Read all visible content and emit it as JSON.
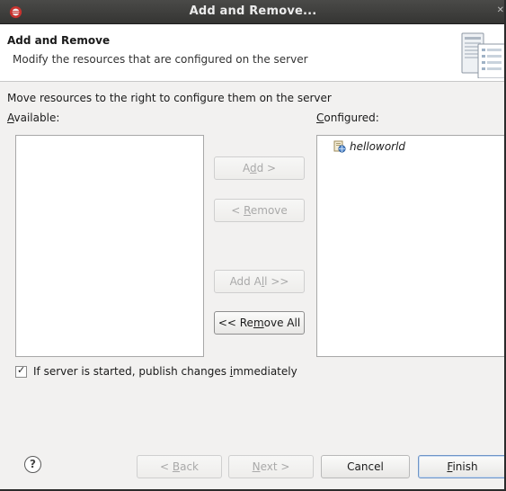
{
  "window": {
    "title": "Add and Remove..."
  },
  "header": {
    "title": "Add and Remove",
    "description": "Modify the resources that are configured on the server"
  },
  "instruction": "Move resources to the right to configure them on the server",
  "available": {
    "label_mnemonic": "A",
    "label_rest": "vailable:",
    "items": []
  },
  "configured": {
    "label_mnemonic": "C",
    "label_rest": "onfigured:",
    "items": [
      {
        "label": "helloworld",
        "icon": "web-project-icon"
      }
    ]
  },
  "buttons": {
    "add": {
      "pre": "A",
      "mn": "d",
      "post": "d >",
      "enabled": false
    },
    "remove": {
      "pre": "< ",
      "mn": "R",
      "post": "emove",
      "enabled": false
    },
    "add_all": {
      "pre": "Add A",
      "mn": "l",
      "post": "l >>",
      "enabled": false
    },
    "remove_all": {
      "pre": "<< Re",
      "mn": "m",
      "post": "ove All",
      "enabled": true
    }
  },
  "publish": {
    "checked": true,
    "pre": "If server is started, publish changes ",
    "mn": "i",
    "post": "mmediately"
  },
  "footer": {
    "help_glyph": "?",
    "back": {
      "pre": "< ",
      "mn": "B",
      "post": "ack",
      "enabled": false
    },
    "next": {
      "pre": "",
      "mn": "N",
      "post": "ext >",
      "enabled": false
    },
    "cancel": {
      "label": "Cancel",
      "enabled": true
    },
    "finish": {
      "pre": "",
      "mn": "F",
      "post": "inish",
      "enabled": true
    }
  },
  "icons": {
    "app": "eclipse-app-icon",
    "close": "close-icon",
    "header_graphic": "server-wizard-icon",
    "help": "help-icon"
  },
  "colors": {
    "titlebar": "#353533",
    "default_button_border": "#6f95c7",
    "disabled_text": "#a9a9a9"
  }
}
